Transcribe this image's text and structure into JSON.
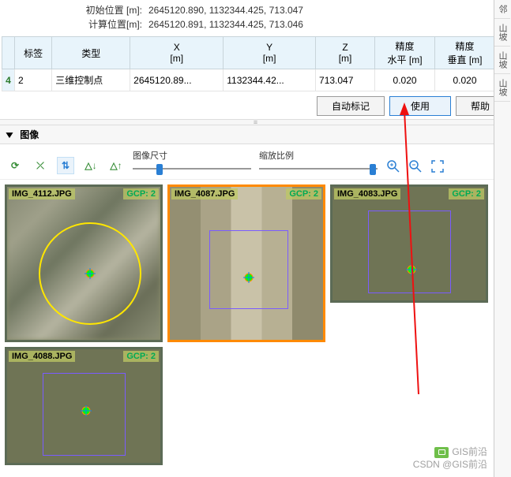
{
  "info": {
    "initial_label": "初始位置 [m]:",
    "initial_val": "2645120.890, 1132344.425, 713.047",
    "computed_label": "计算位置[m]:",
    "computed_val": "2645120.891, 1132344.425, 713.046"
  },
  "table": {
    "headers": [
      "标签",
      "类型",
      "X\n[m]",
      "Y\n[m]",
      "Z\n[m]",
      "精度\n水平 [m]",
      "精度\n垂直 [m]"
    ],
    "row_num": "4",
    "cells": [
      "2",
      "三维控制点",
      "2645120.89...",
      "1132344.42...",
      "713.047",
      "0.020",
      "0.020"
    ]
  },
  "buttons": {
    "auto": "自动标记",
    "use": "使用",
    "help": "帮助"
  },
  "panel": {
    "title": "图像"
  },
  "toolbar": {
    "size_label": "图像尺寸",
    "zoom_label": "缩放比例"
  },
  "thumbs": [
    {
      "name": "IMG_4112.JPG",
      "gcp": "GCP: 2"
    },
    {
      "name": "IMG_4087.JPG",
      "gcp": "GCP: 2"
    },
    {
      "name": "IMG_4083.JPG",
      "gcp": "GCP: 2"
    },
    {
      "name": "IMG_4088.JPG",
      "gcp": "GCP: 2"
    }
  ],
  "sidebar": [
    "邻",
    "山坡",
    "山坡",
    "山坡"
  ],
  "watermark": {
    "line1": "GIS前沿",
    "line2": "CSDN @GIS前沿"
  }
}
